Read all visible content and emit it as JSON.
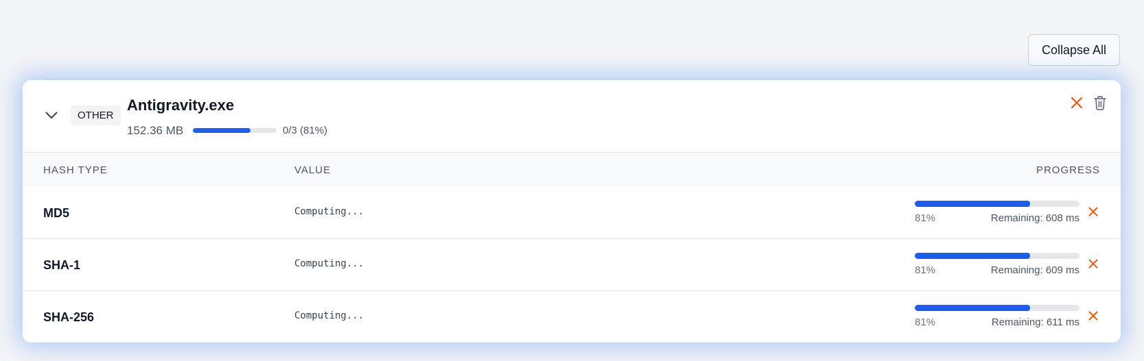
{
  "toolbar": {
    "collapse_all_label": "Collapse All"
  },
  "file": {
    "type_badge": "OTHER",
    "name": "Antigravity.exe",
    "size": "152.36 MB",
    "progress_fraction": 0.69,
    "progress_text": "0/3 (81%)",
    "icons": {
      "expand": "chevron-down-icon",
      "cancel": "close-icon",
      "delete": "trash-icon"
    }
  },
  "table": {
    "headers": {
      "hash_type": "HASH TYPE",
      "value": "VALUE",
      "progress": "PROGRESS"
    },
    "rows": [
      {
        "hash_type": "MD5",
        "value": "Computing...",
        "percent_label": "81%",
        "progress_fraction": 0.7,
        "remaining": "Remaining: 608 ms"
      },
      {
        "hash_type": "SHA-1",
        "value": "Computing...",
        "percent_label": "81%",
        "progress_fraction": 0.7,
        "remaining": "Remaining: 609 ms"
      },
      {
        "hash_type": "SHA-256",
        "value": "Computing...",
        "percent_label": "81%",
        "progress_fraction": 0.7,
        "remaining": "Remaining: 611 ms"
      }
    ]
  },
  "colors": {
    "accent": "#1d5ee8",
    "cancel": "#ea580c",
    "glow": "#3b82f6"
  }
}
